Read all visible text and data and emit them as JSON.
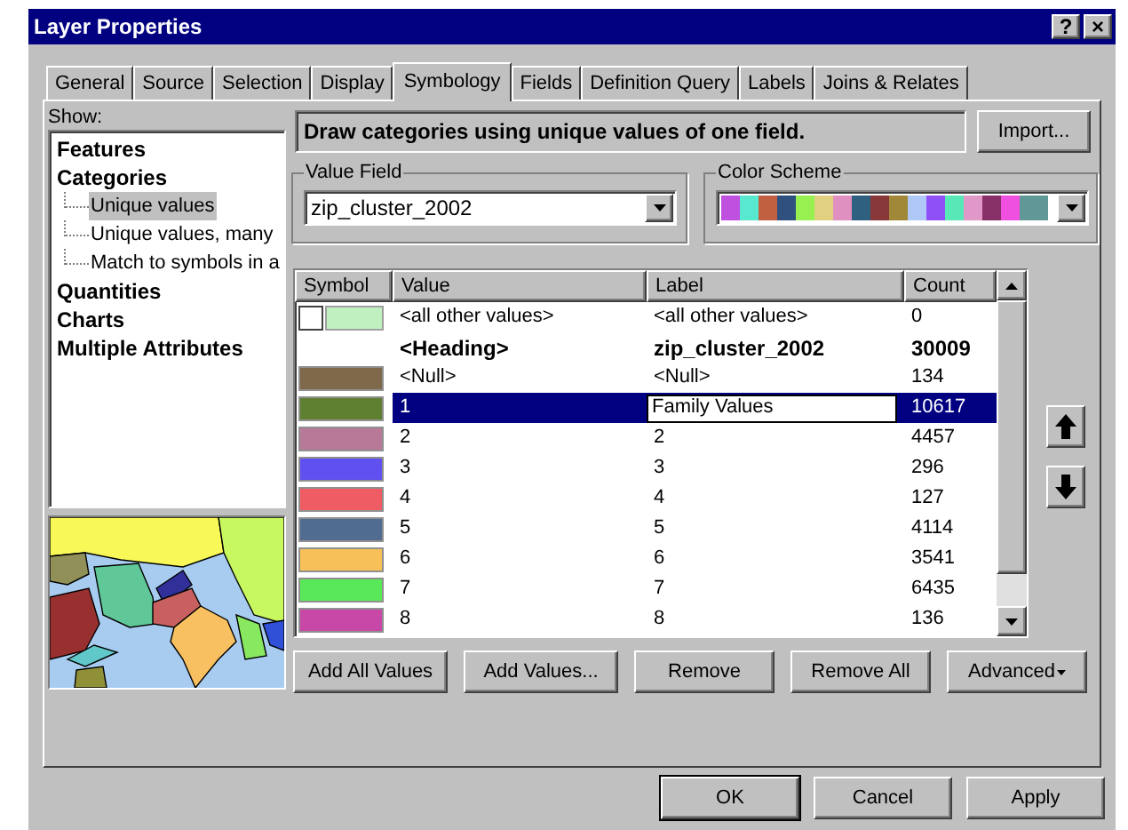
{
  "window": {
    "title": "Layer Properties",
    "buttons": [
      "?",
      "×"
    ]
  },
  "tabs": [
    {
      "label": "General",
      "selected": false
    },
    {
      "label": "Source",
      "selected": false
    },
    {
      "label": "Selection",
      "selected": false
    },
    {
      "label": "Display",
      "selected": false
    },
    {
      "label": "Symbology",
      "selected": true
    },
    {
      "label": "Fields",
      "selected": false
    },
    {
      "label": "Definition Query",
      "selected": false
    },
    {
      "label": "Labels",
      "selected": false
    },
    {
      "label": "Joins & Relates",
      "selected": false
    }
  ],
  "show": {
    "label": "Show:",
    "items": [
      {
        "label": "Features",
        "selected": false
      },
      {
        "label": "Categories",
        "selected": false,
        "children": [
          {
            "label": "Unique values",
            "selected": true
          },
          {
            "label": "Unique values, many",
            "selected": false
          },
          {
            "label": "Match to symbols in a",
            "selected": false
          }
        ]
      },
      {
        "label": "Quantities",
        "selected": false
      },
      {
        "label": "Charts",
        "selected": false
      },
      {
        "label": "Multiple Attributes",
        "selected": false
      }
    ]
  },
  "preview": {
    "kind": "picture"
  },
  "description": "Draw categories using unique values of one field.",
  "import_button": "Import...",
  "value_field": {
    "label": "Value Field",
    "value": "zip_cluster_2002"
  },
  "color_scheme": {
    "label": "Color Scheme"
  },
  "table": {
    "columns": [
      "Symbol",
      "Value",
      "Label",
      "Count"
    ],
    "rows": [
      {
        "kind": "other",
        "value": "<all other values>",
        "label": "<all other values>",
        "count": "0",
        "selected": false
      },
      {
        "kind": "heading",
        "value": "<Heading>",
        "label": "zip_cluster_2002",
        "count": "30009",
        "selected": false
      },
      {
        "kind": "value",
        "color": "#80684a",
        "value": "<Null>",
        "label": "<Null>",
        "count": "134",
        "selected": false
      },
      {
        "kind": "value",
        "color": "#5f8030",
        "value": "1",
        "label": "Family Values",
        "count": "10617",
        "selected": true
      },
      {
        "kind": "value",
        "color": "#b87898",
        "value": "2",
        "label": "2",
        "count": "4457",
        "selected": false
      },
      {
        "kind": "value",
        "color": "#6050f0",
        "value": "3",
        "label": "3",
        "count": "296",
        "selected": false
      },
      {
        "kind": "value",
        "color": "#f05c64",
        "value": "4",
        "label": "4",
        "count": "127",
        "selected": false
      },
      {
        "kind": "value",
        "color": "#506c90",
        "value": "5",
        "label": "5",
        "count": "4114",
        "selected": false
      },
      {
        "kind": "value",
        "color": "#f8c058",
        "value": "6",
        "label": "6",
        "count": "3541",
        "selected": false
      },
      {
        "kind": "value",
        "color": "#58e858",
        "value": "7",
        "label": "7",
        "count": "6435",
        "selected": false
      },
      {
        "kind": "value",
        "color": "#c848a8",
        "value": "8",
        "label": "8",
        "count": "136",
        "selected": false
      }
    ]
  },
  "table_buttons": [
    "Add All Values",
    "Add Values...",
    "Remove",
    "Remove All",
    "Advanced"
  ],
  "footer_buttons": [
    "OK",
    "Cancel",
    "Apply"
  ]
}
